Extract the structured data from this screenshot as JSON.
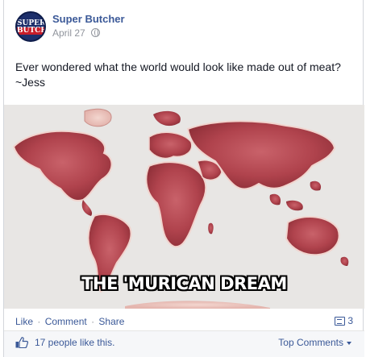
{
  "post": {
    "page_name": "Super Butcher",
    "date": "April 27",
    "avatar_text_top": "SUPER",
    "avatar_text_bottom": "BUTCHER",
    "message": "Ever wondered what the world would look like made out of meat? ~Jess",
    "image_caption": "THE 'MURICAN DREAM"
  },
  "actions": {
    "like": "Like",
    "comment": "Comment",
    "share": "Share",
    "separator": "·",
    "comment_count": "3"
  },
  "footer": {
    "likes_text": "17 people like this.",
    "top_comments": "Top Comments"
  },
  "colors": {
    "link": "#3b5998",
    "meat": "#b84a52",
    "background_photo": "#e9e7e5"
  },
  "icons": {
    "privacy": "globe-icon",
    "comments": "comment-icon",
    "like": "thumbs-up-icon",
    "dropdown": "caret-down-icon"
  }
}
